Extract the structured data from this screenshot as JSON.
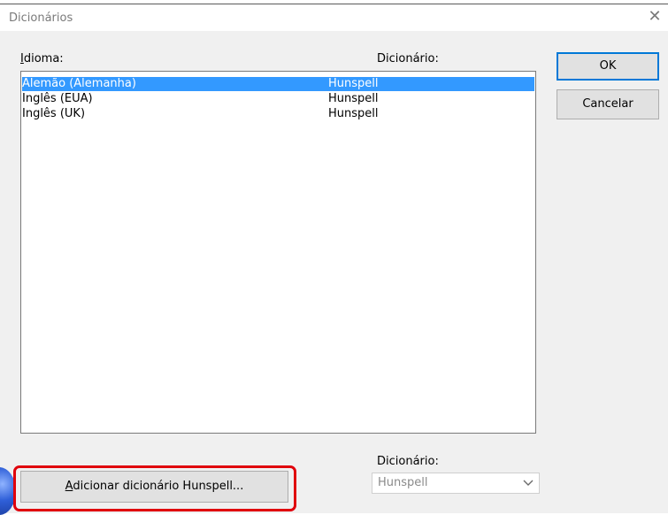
{
  "window": {
    "title": "Dicionários"
  },
  "columns": {
    "idioma_label": "Idioma:",
    "idioma_accel": "I",
    "idioma_rest": "dioma:",
    "dicionario_label": "Dicionário:"
  },
  "rows": [
    {
      "language": "Alemão (Alemanha)",
      "dictionary": "Hunspell",
      "selected": true
    },
    {
      "language": "Inglês (EUA)",
      "dictionary": "Hunspell",
      "selected": false
    },
    {
      "language": "Inglês (UK)",
      "dictionary": "Hunspell",
      "selected": false
    }
  ],
  "buttons": {
    "ok": "OK",
    "cancel": "Cancelar"
  },
  "add_button": {
    "accel": "A",
    "rest": "dicionar dicionário Hunspell...",
    "full": "Adicionar dicionário Hunspell..."
  },
  "bottom": {
    "dicionario_label": "Dicionário:",
    "combo_value": "Hunspell"
  },
  "colors": {
    "selection": "#3399ff",
    "focus_border": "#0078d7",
    "highlight_red": "#e0000c"
  },
  "icons": {
    "close": "close-icon",
    "dropdown": "chevron-down-icon"
  }
}
